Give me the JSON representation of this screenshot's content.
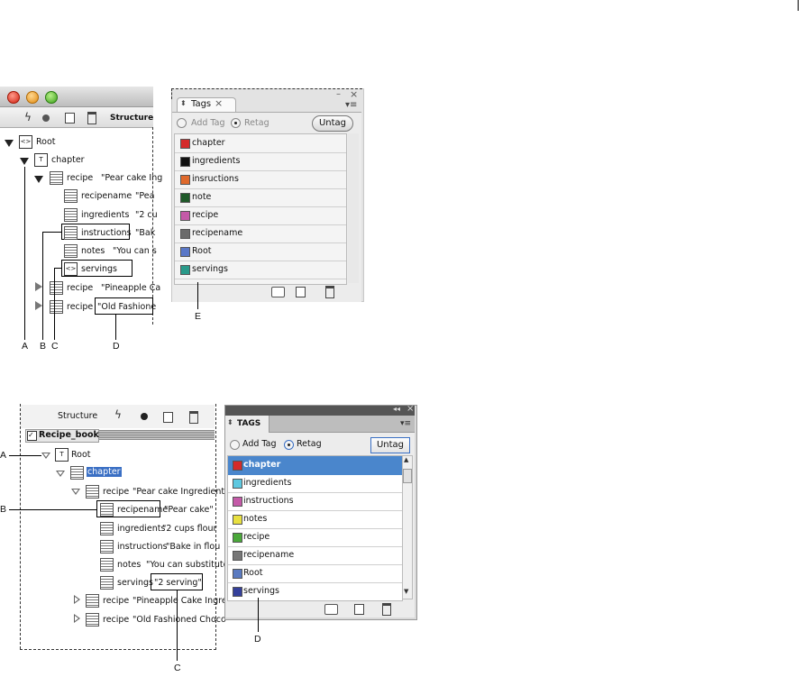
{
  "top_structure": {
    "toolbar_label": "Structure",
    "rows": [
      {
        "label": "Root",
        "value": ""
      },
      {
        "label": "chapter",
        "value": ""
      },
      {
        "label": "recipe",
        "value": "\"Pear cake Ing"
      },
      {
        "label": "recipename",
        "value": "\"Pea"
      },
      {
        "label": "ingredients",
        "value": "\"2 cu"
      },
      {
        "label": "instructions",
        "value": "\"Bak"
      },
      {
        "label": "notes",
        "value": "\"You can s"
      },
      {
        "label": "servings",
        "value": ""
      },
      {
        "label": "recipe",
        "value": "\"Pineapple Ca"
      },
      {
        "label": "recipe",
        "value": "\"Old Fashione"
      }
    ]
  },
  "top_tags": {
    "tab_label": "Tags",
    "add_tag_label": "Add Tag",
    "retag_label": "Retag",
    "untag_label": "Untag",
    "items": [
      {
        "label": "chapter",
        "color": "#d42a2a"
      },
      {
        "label": "ingredients",
        "color": "#111111"
      },
      {
        "label": "insructions",
        "color": "#e06a2c"
      },
      {
        "label": "note",
        "color": "#1f5a2a"
      },
      {
        "label": "recipe",
        "color": "#c45aa8"
      },
      {
        "label": "recipename",
        "color": "#6b6b6b"
      },
      {
        "label": "Root",
        "color": "#5a78c8"
      },
      {
        "label": "servings",
        "color": "#2a9a8a"
      }
    ]
  },
  "bottom_structure": {
    "toolbar_label": "Structure",
    "document_label": "Recipe_book",
    "rows": [
      {
        "label": "Root",
        "value": ""
      },
      {
        "label": "chapter",
        "value": ""
      },
      {
        "label": "recipe",
        "value": "\"Pear cake Ingredients"
      },
      {
        "label": "recipename",
        "value": "\"Pear cake\""
      },
      {
        "label": "ingredients",
        "value": "\"2 cups flour"
      },
      {
        "label": "instructions",
        "value": "\"Bake in flou"
      },
      {
        "label": "notes",
        "value": "\"You can substitute"
      },
      {
        "label": "servings",
        "value": "\"2 serving\""
      },
      {
        "label": "recipe",
        "value": "\"Pineapple Cake Ingre"
      },
      {
        "label": "recipe",
        "value": "\"Old Fashioned Choco"
      }
    ]
  },
  "bottom_tags": {
    "tab_label": "TAGS",
    "add_tag_label": "Add Tag",
    "retag_label": "Retag",
    "untag_label": "Untag",
    "items": [
      {
        "label": "chapter",
        "color": "#d42a2a"
      },
      {
        "label": "ingredients",
        "color": "#5ec8e0"
      },
      {
        "label": "instructions",
        "color": "#c45aa8"
      },
      {
        "label": "notes",
        "color": "#e8e040"
      },
      {
        "label": "recipe",
        "color": "#4aa83a"
      },
      {
        "label": "recipename",
        "color": "#777777"
      },
      {
        "label": "Root",
        "color": "#5a7ac0"
      },
      {
        "label": "servings",
        "color": "#34409a"
      }
    ]
  },
  "callouts": {
    "top": [
      "A",
      "B",
      "C",
      "D",
      "E"
    ],
    "bottom": [
      "A",
      "B",
      "C",
      "D"
    ]
  }
}
